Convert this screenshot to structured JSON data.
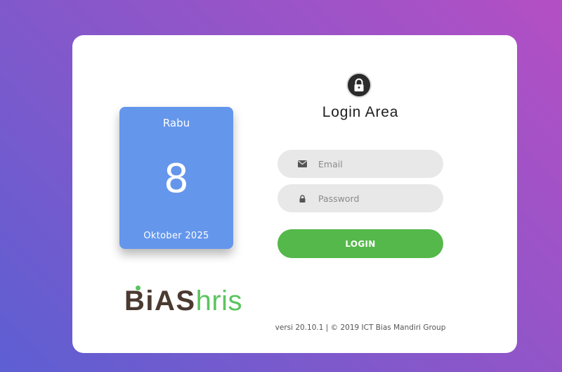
{
  "date_tile": {
    "day_name": "Rabu",
    "day_number": "8",
    "month_year": "Oktober 2025"
  },
  "logo": {
    "part1": "BiAS",
    "part2": "hris"
  },
  "login": {
    "title": "Login Area",
    "email_placeholder": "Email",
    "password_placeholder": "Password",
    "button_label": "LOGIN"
  },
  "footer": {
    "version_text": "versi 20.10.1 | © 2019 ICT Bias Mandiri Group"
  },
  "icons": {
    "lock": "lock-icon",
    "email": "envelope-icon",
    "password": "padlock-icon"
  },
  "colors": {
    "tile": "#6496ec",
    "button": "#55b84a",
    "logo_green": "#5ac45f",
    "logo_brown": "#4a3a30"
  }
}
